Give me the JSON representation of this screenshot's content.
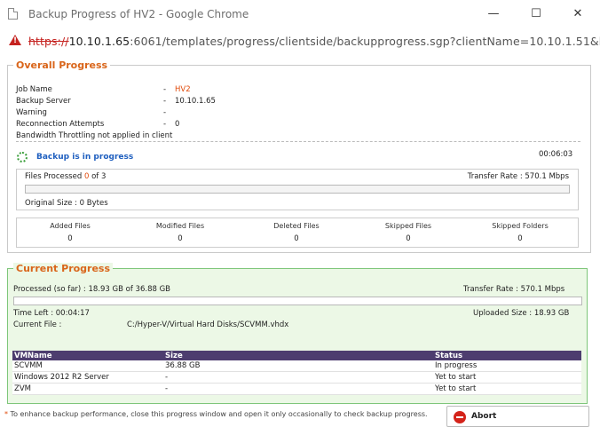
{
  "window": {
    "title": "Backup Progress of HV2 - Google Chrome",
    "minimize_glyph": "—",
    "maximize_glyph": "☐",
    "close_glyph": "✕"
  },
  "address": {
    "protocol": "https://",
    "host": "10.10.1.65",
    "path": ":6061/templates/progress/clientside/backupprogress.sgp?clientName=10.10.1.51&bac"
  },
  "overall": {
    "legend": "Overall Progress",
    "fields": [
      {
        "label": "Job Name",
        "sep": "-",
        "value": "HV2"
      },
      {
        "label": "Backup Server",
        "sep": "-",
        "value": "10.10.1.65"
      },
      {
        "label": "Warning",
        "sep": "-",
        "value": ""
      },
      {
        "label": "Reconnection Attempts",
        "sep": "-",
        "value": "0"
      }
    ],
    "throttle_note": "Bandwidth Throttling not applied in client",
    "elapsed": "00:06:03",
    "status": "Backup is in progress",
    "files_processed_label": "Files Processed",
    "files_processed_done": "0",
    "files_processed_of": "of 3",
    "transfer_rate": "Transfer Rate : 570.1 Mbps",
    "progress_fraction": 0.0,
    "original_size": "Original Size : 0 Bytes",
    "stats": [
      {
        "label": "Added Files",
        "value": "0"
      },
      {
        "label": "Modified Files",
        "value": "0"
      },
      {
        "label": "Deleted Files",
        "value": "0"
      },
      {
        "label": "Skipped Files",
        "value": "0"
      },
      {
        "label": "Skipped Folders",
        "value": "0"
      }
    ]
  },
  "current": {
    "legend": "Current Progress",
    "processed": "Processed (so far) : 18.93 GB  of  36.88 GB",
    "transfer_rate": "Transfer Rate :  570.1 Mbps",
    "progress_fraction": 0.0,
    "time_left": "Time Left : 00:04:17",
    "uploaded_size": "Uploaded Size : 18.93 GB",
    "current_file_label": "Current File :",
    "current_file": "C:/Hyper-V/Virtual Hard Disks/SCVMM.vhdx",
    "table": {
      "headers": [
        "VMName",
        "Size",
        "Status"
      ],
      "rows": [
        [
          "SCVMM",
          "36.88 GB",
          "In progress"
        ],
        [
          "Windows 2012 R2 Server",
          "-",
          "Yet to start"
        ],
        [
          "ZVM",
          "-",
          "Yet to start"
        ]
      ]
    }
  },
  "footer": {
    "note_star": "*",
    "note": "To enhance backup performance, close this progress window and open it only occasionally to check backup progress.",
    "abort_label": "Abort"
  },
  "colors": {
    "legend": "#d9651a",
    "status_blue": "#1f5fbf",
    "table_header": "#4d3d6f",
    "current_bg": "#ecf8e6",
    "current_border": "#7ec67a"
  }
}
